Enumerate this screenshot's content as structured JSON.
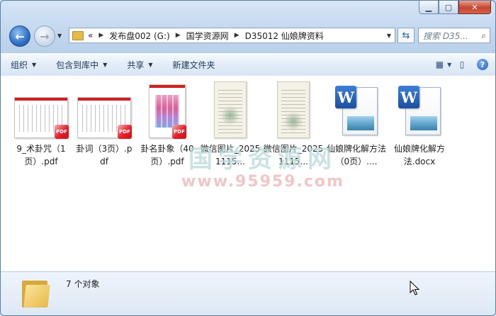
{
  "navigation": {
    "breadcrumb_prefix": "«",
    "breadcrumbs": [
      "发布盘002 (G:)",
      "国学资源网",
      "D35012 仙娘牌资料"
    ],
    "search_placeholder": "搜索 D35..."
  },
  "toolbar": {
    "organize": "组织",
    "include_in_library": "包含到库中",
    "share": "共享",
    "new_folder": "新建文件夹"
  },
  "files": [
    {
      "name": "9_术卦咒（1页）.pdf",
      "type": "pdf"
    },
    {
      "name": "卦词（3页）.pdf",
      "type": "pdf"
    },
    {
      "name": "卦名卦象（40页）.pdf",
      "type": "pdf-color"
    },
    {
      "name": "微信图片_20251115...",
      "type": "image"
    },
    {
      "name": "微信图片_20251115...",
      "type": "image"
    },
    {
      "name": "仙娘牌化解方法（0页）....",
      "type": "docx"
    },
    {
      "name": "仙娘牌化解方法.docx",
      "type": "docx"
    }
  ],
  "watermark": {
    "text": "国学资源网",
    "url": "www.95959.com"
  },
  "status": {
    "count": "7 个对象"
  },
  "icons": {
    "pdf_badge": "PDF",
    "word_letter": "W",
    "back": "back-arrow-icon",
    "forward": "forward-arrow-icon"
  }
}
